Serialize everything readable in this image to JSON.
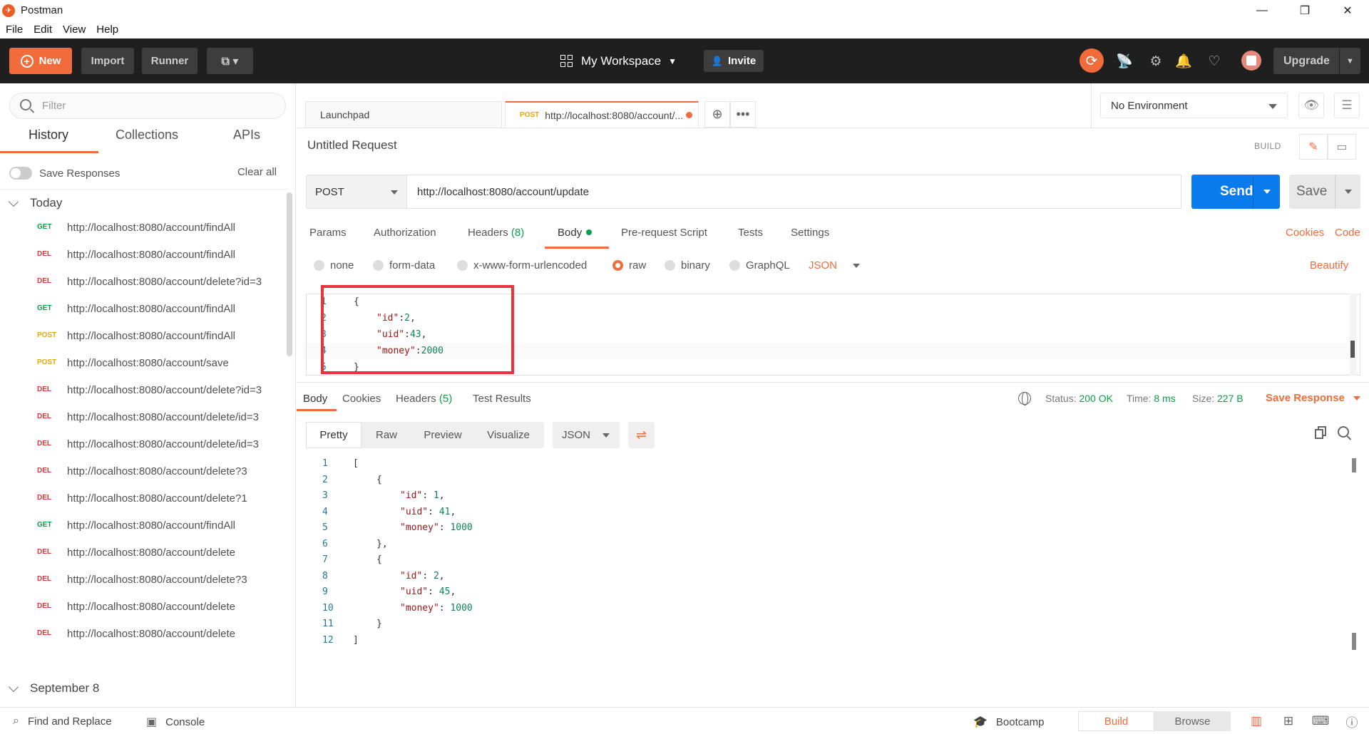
{
  "window": {
    "title": "Postman",
    "minimize": "—",
    "restore": "❐",
    "close": "✕"
  },
  "menu": [
    "File",
    "Edit",
    "View",
    "Help"
  ],
  "header": {
    "new_label": "New",
    "import_label": "Import",
    "runner_label": "Runner",
    "workspace_label": "My Workspace",
    "invite_label": "Invite",
    "upgrade_label": "Upgrade"
  },
  "sidebar": {
    "filter_placeholder": "Filter",
    "tabs": [
      "History",
      "Collections",
      "APIs"
    ],
    "save_responses_label": "Save Responses",
    "clear_all_label": "Clear all",
    "group_today": "Today",
    "group_sep": "September 8",
    "history": [
      {
        "method": "GET",
        "url": "http://localhost:8080/account/findAll"
      },
      {
        "method": "DEL",
        "url": "http://localhost:8080/account/findAll"
      },
      {
        "method": "DEL",
        "url": "http://localhost:8080/account/delete?id=3"
      },
      {
        "method": "GET",
        "url": "http://localhost:8080/account/findAll"
      },
      {
        "method": "POST",
        "url": "http://localhost:8080/account/findAll"
      },
      {
        "method": "POST",
        "url": "http://localhost:8080/account/save"
      },
      {
        "method": "DEL",
        "url": "http://localhost:8080/account/delete?id=3"
      },
      {
        "method": "DEL",
        "url": "http://localhost:8080/account/delete/id=3"
      },
      {
        "method": "DEL",
        "url": "http://localhost:8080/account/delete/id=3"
      },
      {
        "method": "DEL",
        "url": "http://localhost:8080/account/delete?3"
      },
      {
        "method": "DEL",
        "url": "http://localhost:8080/account/delete?1"
      },
      {
        "method": "GET",
        "url": "http://localhost:8080/account/findAll"
      },
      {
        "method": "DEL",
        "url": "http://localhost:8080/account/delete"
      },
      {
        "method": "DEL",
        "url": "http://localhost:8080/account/delete?3"
      },
      {
        "method": "DEL",
        "url": "http://localhost:8080/account/delete"
      },
      {
        "method": "DEL",
        "url": "http://localhost:8080/account/delete"
      }
    ]
  },
  "tabs": {
    "launchpad": "Launchpad",
    "active_method": "POST",
    "active_label": "http://localhost:8080/account/..."
  },
  "environment": {
    "selected": "No Environment"
  },
  "request": {
    "title": "Untitled Request",
    "build_label": "BUILD",
    "method": "POST",
    "url": "http://localhost:8080/account/update",
    "send_label": "Send",
    "save_label": "Save",
    "subtabs": {
      "params": "Params",
      "authorization": "Authorization",
      "headers": "Headers",
      "headers_count": "(8)",
      "body": "Body",
      "prerequest": "Pre-request Script",
      "tests": "Tests",
      "settings": "Settings"
    },
    "cookies_label": "Cookies",
    "code_label": "Code",
    "body_types": [
      "none",
      "form-data",
      "x-www-form-urlencoded",
      "raw",
      "binary",
      "GraphQL"
    ],
    "body_format": "JSON",
    "beautify_label": "Beautify",
    "body_lines": [
      {
        "n": "1",
        "text": "{"
      },
      {
        "n": "2",
        "key": "\"id\"",
        "sep": ":",
        "val": "2",
        "end": ","
      },
      {
        "n": "3",
        "key": "\"uid\"",
        "sep": ":",
        "val": "43",
        "end": ","
      },
      {
        "n": "4",
        "key": "\"money\"",
        "sep": ":",
        "val": "2000",
        "end": ""
      },
      {
        "n": "5",
        "text": "}"
      }
    ]
  },
  "response": {
    "tabs": {
      "body": "Body",
      "cookies": "Cookies",
      "headers": "Headers",
      "headers_count": "(5)",
      "test_results": "Test Results"
    },
    "status_label": "Status:",
    "status_value": "200 OK",
    "time_label": "Time:",
    "time_value": "8 ms",
    "size_label": "Size:",
    "size_value": "227 B",
    "save_response_label": "Save Response",
    "views": [
      "Pretty",
      "Raw",
      "Preview",
      "Visualize"
    ],
    "format": "JSON",
    "lines": [
      {
        "n": "1",
        "indent": 0,
        "text": "["
      },
      {
        "n": "2",
        "indent": 1,
        "text": "{"
      },
      {
        "n": "3",
        "indent": 2,
        "key": "\"id\"",
        "val": "1",
        "end": ","
      },
      {
        "n": "4",
        "indent": 2,
        "key": "\"uid\"",
        "val": "41",
        "end": ","
      },
      {
        "n": "5",
        "indent": 2,
        "key": "\"money\"",
        "val": "1000",
        "end": ""
      },
      {
        "n": "6",
        "indent": 1,
        "text": "},"
      },
      {
        "n": "7",
        "indent": 1,
        "text": "{"
      },
      {
        "n": "8",
        "indent": 2,
        "key": "\"id\"",
        "val": "2",
        "end": ","
      },
      {
        "n": "9",
        "indent": 2,
        "key": "\"uid\"",
        "val": "45",
        "end": ","
      },
      {
        "n": "10",
        "indent": 2,
        "key": "\"money\"",
        "val": "1000",
        "end": ""
      },
      {
        "n": "11",
        "indent": 1,
        "text": "}"
      },
      {
        "n": "12",
        "indent": 0,
        "text": "]"
      }
    ]
  },
  "footer": {
    "find_replace": "Find and Replace",
    "console": "Console",
    "bootcamp": "Bootcamp",
    "build": "Build",
    "browse": "Browse"
  },
  "colors": {
    "accent": "#f26b3a",
    "send_blue": "#097bed",
    "success_green": "#0b9d4a",
    "highlight_red": "#e8323c"
  }
}
